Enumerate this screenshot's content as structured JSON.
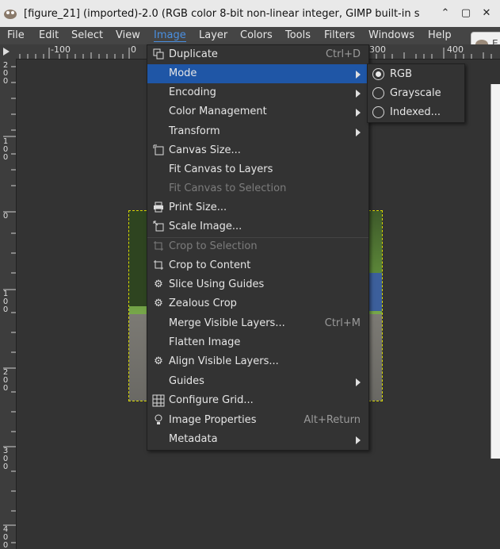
{
  "window": {
    "title": "[figure_21] (imported)-2.0 (RGB color 8-bit non-linear integer, GIMP built-in s",
    "minimize": "⌃",
    "maximize": "▢",
    "close": "✕"
  },
  "menubar": [
    "File",
    "Edit",
    "Select",
    "View",
    "Image",
    "Layer",
    "Colors",
    "Tools",
    "Filters",
    "Windows",
    "Help"
  ],
  "menubar_active": "Image",
  "float_tab_text": "E",
  "ruler": {
    "h_labels": [
      "-100",
      "0",
      "300",
      "400"
    ],
    "v_labels": [
      "200",
      "100",
      "0",
      "100",
      "200",
      "300",
      "400"
    ]
  },
  "image_menu": [
    {
      "label": "Duplicate",
      "accel": "Ctrl+D",
      "icon": "duplicate-icon"
    },
    {
      "label": "Mode",
      "submenu": true,
      "selected": true
    },
    {
      "label": "Encoding",
      "submenu": true
    },
    {
      "label": "Color Management",
      "submenu": true
    },
    {
      "label": "Transform",
      "submenu": true
    },
    {
      "label": "Canvas Size...",
      "icon": "canvas-size-icon"
    },
    {
      "label": "Fit Canvas to Layers"
    },
    {
      "label": "Fit Canvas to Selection",
      "disabled": true
    },
    {
      "label": "Print Size...",
      "icon": "printer-icon"
    },
    {
      "label": "Scale Image...",
      "icon": "scale-image-icon"
    },
    {
      "label": "Crop to Selection",
      "icon": "crop-icon",
      "disabled": true
    },
    {
      "label": "Crop to Content",
      "icon": "crop-icon"
    },
    {
      "label": "Slice Using Guides",
      "icon": "gear-icon"
    },
    {
      "label": "Zealous Crop",
      "icon": "gear-icon"
    },
    {
      "label": "Merge Visible Layers...",
      "accel": "Ctrl+M"
    },
    {
      "label": "Flatten Image"
    },
    {
      "label": "Align Visible Layers...",
      "icon": "gear-icon"
    },
    {
      "label": "Guides",
      "submenu": true
    },
    {
      "label": "Configure Grid...",
      "icon": "grid-icon"
    },
    {
      "label": "Image Properties",
      "accel": "Alt+Return",
      "icon": "info-icon"
    },
    {
      "label": "Metadata",
      "submenu": true
    }
  ],
  "mode_submenu": [
    {
      "label": "RGB",
      "checked": true
    },
    {
      "label": "Grayscale",
      "checked": false
    },
    {
      "label": "Indexed...",
      "checked": false
    }
  ],
  "colors": {
    "menu_bg": "#333333",
    "selected_bg": "#1f56a6",
    "active_menubar": "#4a90e2",
    "selection_outline": "#d8d800"
  }
}
